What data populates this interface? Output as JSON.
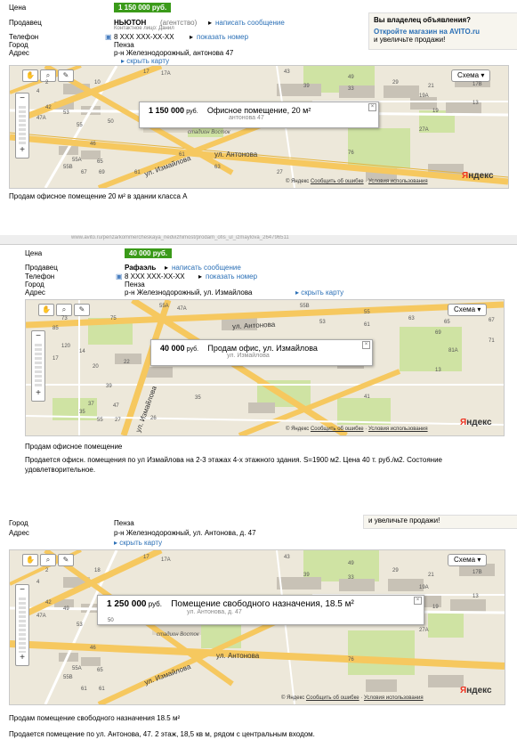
{
  "listing1": {
    "price_label": "Цена",
    "price": "1 150 000 руб.",
    "seller_label": "Продавец",
    "seller_name": "НЬЮТОН",
    "seller_type": "(агентство)",
    "write_message": "написать сообщение",
    "contact_person": "Контактное лицо: Данил",
    "phone_label": "Телефон",
    "phone": "8 XXX XXX-XX-XX",
    "show_number": "показать номер",
    "city_label": "Город",
    "city": "Пенза",
    "address_label": "Адрес",
    "address": "р-н Железнодорожный, антонова 47",
    "hide_map": "скрыть карту",
    "promo_title": "Вы владелец объявления?",
    "promo_link": "Откройте магазин на AVITO.ru",
    "promo_text": "и увеличьте продажи!",
    "map": {
      "scheme": "Схема",
      "balloon_price": "1 150 000",
      "balloon_currency": "руб.",
      "balloon_title": "Офисное помещение, 20 м²",
      "balloon_address": "антонова 47",
      "street_antonova": "ул. Антонова",
      "street_izmaylova": "ул. Измайлова",
      "stadium": "стадион Восток",
      "yandex_ya": "Я",
      "yandex_rest": "ндекс",
      "footer_yandex": "© Яндекс",
      "footer_error": "Сообщить об ошибке",
      "footer_terms": "Условия использования",
      "house_numbers": [
        "17",
        "17A",
        "43",
        "49",
        "39",
        "33",
        "29",
        "21",
        "17B",
        "19A",
        "13",
        "19",
        "2",
        "10",
        "4",
        "42",
        "47A",
        "53",
        "55",
        "50",
        "27A",
        "76",
        "46",
        "55A",
        "55B",
        "65",
        "67",
        "69",
        "61",
        "61",
        "63",
        "27"
      ]
    },
    "description": "Продам офисное помещение 20 м² в здании класса А"
  },
  "listing2": {
    "url_fragment": "www.avito.ru/penza/kommercheskaya_nedvizhimost/prodam_ofis_ul_izmaylova_264796511",
    "price_label": "Цена",
    "price": "40 000 руб.",
    "seller_label": "Продавец",
    "seller_name": "Рафаэль",
    "write_message": "написать сообщение",
    "phone_label": "Телефон",
    "phone": "8 XXX XXX-XX-XX",
    "show_number": "показать номер",
    "city_label": "Город",
    "city": "Пенза",
    "address_label": "Адрес",
    "address": "р-н Железнодорожный, ул. Измайлова",
    "hide_map": "скрыть карту",
    "map": {
      "scheme": "Схема",
      "balloon_price": "40 000",
      "balloon_currency": "руб.",
      "balloon_title": "Продам офис, ул. Измайлова",
      "balloon_address": "ул. Измайлова",
      "street_antonova": "ул. Антонова",
      "street_izmaylova": "ул. Измайлова",
      "yandex_ya": "Я",
      "yandex_rest": "ндекс",
      "footer_yandex": "© Яндекс",
      "footer_error": "Сообщить об ошибке",
      "footer_terms": "Условия использования",
      "house_numbers": [
        "55A",
        "47A",
        "55B",
        "55",
        "53",
        "61",
        "63",
        "65",
        "67",
        "69",
        "71",
        "81A",
        "73",
        "75",
        "85",
        "120",
        "17",
        "14",
        "20",
        "22",
        "13",
        "41",
        "39",
        "37",
        "35",
        "47",
        "55",
        "27",
        "26",
        "35"
      ]
    },
    "title": "Продам офисное помещение",
    "description": "Продается офисн. помещения по ул Измайлова на 2-3 этажах 4-х этажного здания. S=1900 м2. Цена 40 т. руб./м2. Состояние удовлетворительное."
  },
  "listing3": {
    "city_label": "Город",
    "city": "Пенза",
    "address_label": "Адрес",
    "address": "р-н Железнодорожный, ул. Антонова, д. 47",
    "hide_map": "скрыть карту",
    "promo_text": "и увеличьте продажи!",
    "map": {
      "scheme": "Схема",
      "balloon_price": "1 250 000",
      "balloon_currency": "руб.",
      "balloon_title": "Помещение свободного назначения, 18.5 м²",
      "balloon_address": "ул. Антонова, д. 47",
      "street_antonova": "ул. Антонова",
      "street_izmaylova": "ул. Измайлова",
      "stadium": "стадион Восток",
      "yandex_ya": "Я",
      "yandex_rest": "ндекс",
      "footer_yandex": "© Яндекс",
      "footer_error": "Сообщить об ошибке",
      "footer_terms": "Условия использования",
      "house_numbers": [
        "17",
        "17A",
        "43",
        "49",
        "39",
        "33",
        "29",
        "21",
        "17B",
        "19A",
        "13",
        "19",
        "2",
        "18",
        "4",
        "42",
        "47A",
        "49",
        "53",
        "50",
        "27A",
        "76",
        "46",
        "55A",
        "55B",
        "65",
        "61",
        "61"
      ]
    },
    "title": "Продам помещение свободного назначения 18.5 м²",
    "description": "Продается помещение по ул. Антонова, 47. 2 этаж, 18,5 кв м, рядом с центральным входом."
  },
  "colors": {
    "price_bg": "#3a9a19",
    "link": "#2a6fb6",
    "road_major": "#f6c85f",
    "road_minor": "#ffffff",
    "park": "#cfe3a3",
    "building": "#c8c2b6",
    "map_bg": "#ede8da",
    "yandex_red": "#e32"
  }
}
